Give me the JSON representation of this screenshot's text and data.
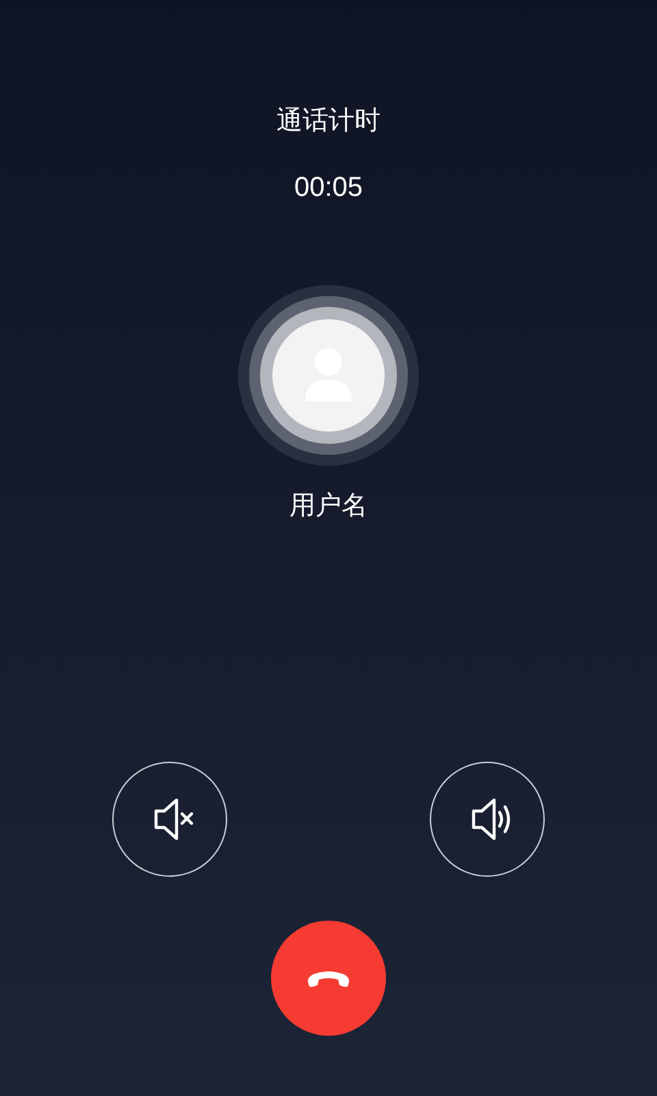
{
  "call": {
    "title": "通话计时",
    "timer": "00:05",
    "caller": {
      "name": "用户名"
    }
  },
  "controls": [
    {
      "kind": "mute"
    },
    {
      "kind": "speaker"
    }
  ],
  "hangup": {
    "kind": "hangup"
  }
}
